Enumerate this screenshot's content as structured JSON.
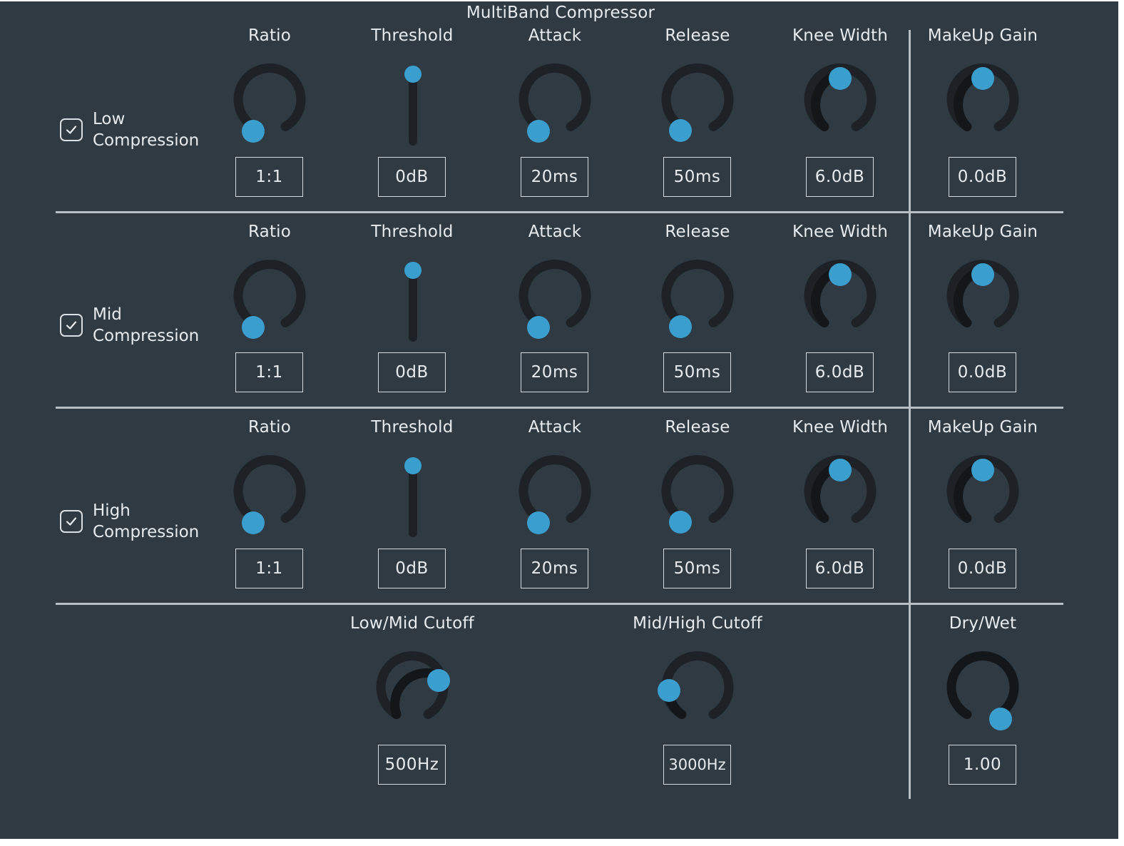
{
  "title": "MultiBand Compressor",
  "colors": {
    "background": "#2f3a43",
    "accent": "#3a9fcf",
    "track": "#1e2226",
    "divider": "#b7bec4"
  },
  "param_labels": {
    "ratio": "Ratio",
    "threshold": "Threshold",
    "attack": "Attack",
    "release": "Release",
    "knee_width": "Knee Width",
    "makeup_gain": "MakeUp Gain"
  },
  "bands": [
    {
      "label_line1": "Low",
      "label_line2": "Compression",
      "enabled": true,
      "ratio": "1:1",
      "threshold": "0dB",
      "attack": "20ms",
      "release": "50ms",
      "knee_width": "6.0dB",
      "makeup_gain": "0.0dB"
    },
    {
      "label_line1": "Mid",
      "label_line2": "Compression",
      "enabled": true,
      "ratio": "1:1",
      "threshold": "0dB",
      "attack": "20ms",
      "release": "50ms",
      "knee_width": "6.0dB",
      "makeup_gain": "0.0dB"
    },
    {
      "label_line1": "High",
      "label_line2": "Compression",
      "enabled": true,
      "ratio": "1:1",
      "threshold": "0dB",
      "attack": "20ms",
      "release": "50ms",
      "knee_width": "6.0dB",
      "makeup_gain": "0.0dB"
    }
  ],
  "global": {
    "low_mid_cutoff_label": "Low/Mid Cutoff",
    "low_mid_cutoff_value": "500Hz",
    "mid_high_cutoff_label": "Mid/High Cutoff",
    "mid_high_cutoff_value": "3000Hz",
    "dry_wet_label": "Dry/Wet",
    "dry_wet_value": "1.00"
  }
}
